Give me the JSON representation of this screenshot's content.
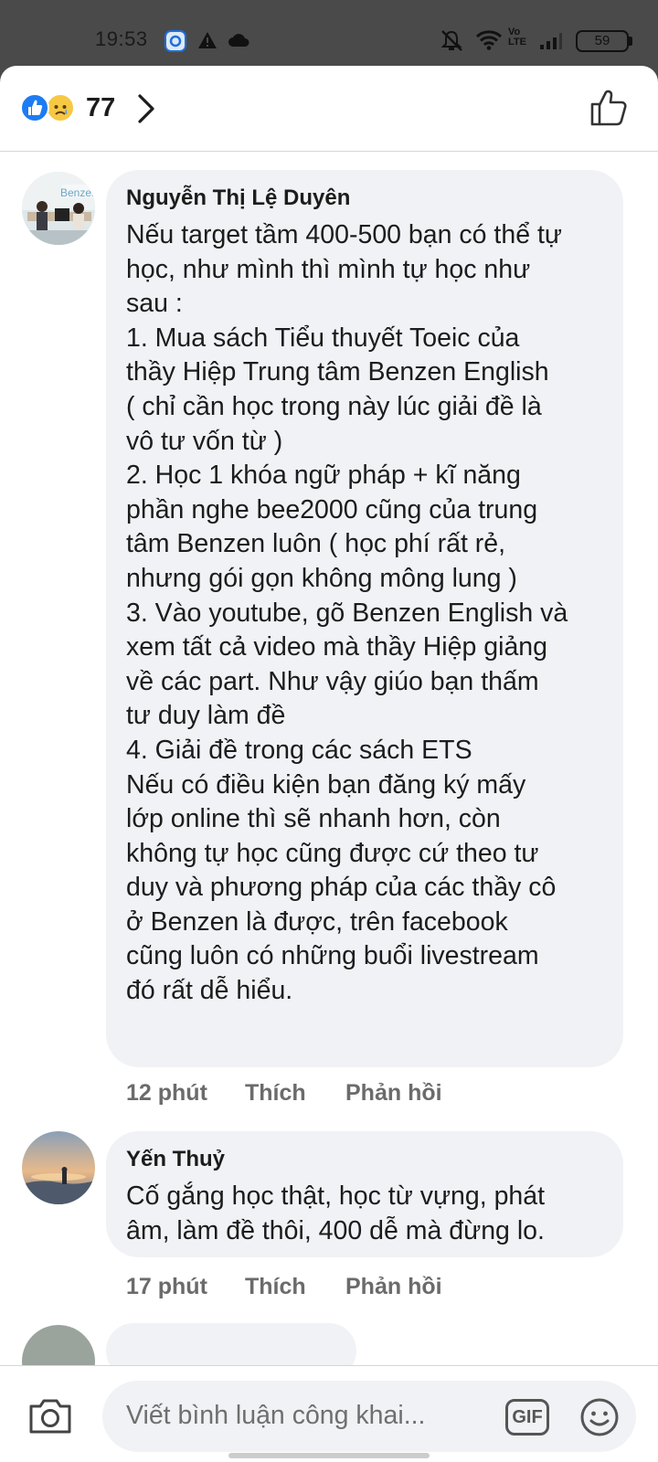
{
  "status_bar": {
    "time": "19:53",
    "icons": [
      "app-notification-icon",
      "warning-icon",
      "cloud-icon",
      "mute-icon",
      "wifi-icon",
      "volte-icon",
      "signal-icon",
      "battery-icon"
    ],
    "battery": "59",
    "volte_top": "Vo",
    "volte_bottom": "LTE"
  },
  "reactions": {
    "count": "77",
    "types": [
      "like",
      "sad"
    ]
  },
  "comments": [
    {
      "author": "Nguyễn Thị Lệ Duyên",
      "avatar_text": "Benzen",
      "lines": [
        "Nếu target tầm 400-500 bạn có thể tự",
        "học, như mình thì mình tự học như",
        "sau :",
        "1. Mua sách Tiểu thuyết Toeic của",
        "thầy Hiệp Trung tâm Benzen English",
        "( chỉ cần học trong này lúc giải đề là",
        "vô tư vốn từ )",
        "2. Học 1 khóa ngữ pháp + kĩ năng",
        "phần nghe bee2000 cũng của trung",
        "tâm Benzen luôn ( học phí rất rẻ,",
        "nhưng gói gọn không mông lung )",
        "3. Vào youtube, gõ Benzen English và",
        "xem tất cả video mà thầy Hiệp giảng",
        "về các part. Như vậy giúo bạn thấm",
        "tư duy làm đề",
        "4. Giải đề trong các sách ETS",
        "Nếu có điều kiện bạn đăng ký mấy",
        "lớp online thì sẽ nhanh hơn, còn",
        "không tự học cũng được cứ theo tư",
        "duy và phương pháp của các thầy cô",
        "ở Benzen là được, trên facebook",
        "cũng luôn có những buổi livestream",
        "đó rất dễ hiểu."
      ],
      "time": "12 phút",
      "like_label": "Thích",
      "reply_label": "Phản hồi"
    },
    {
      "author": "Yến Thuỷ",
      "lines": [
        "Cố gắng học thật, học từ vựng, phát",
        "âm, làm đề thôi, 400 dễ mà đừng lo."
      ],
      "time": "17 phút",
      "like_label": "Thích",
      "reply_label": "Phản hồi"
    }
  ],
  "composer": {
    "placeholder": "Viết bình luận công khai...",
    "gif_label": "GIF"
  },
  "colors": {
    "bubble": "#f0f2f5",
    "accent": "#1d7cf2",
    "status_bar": "#4a4a4a"
  }
}
